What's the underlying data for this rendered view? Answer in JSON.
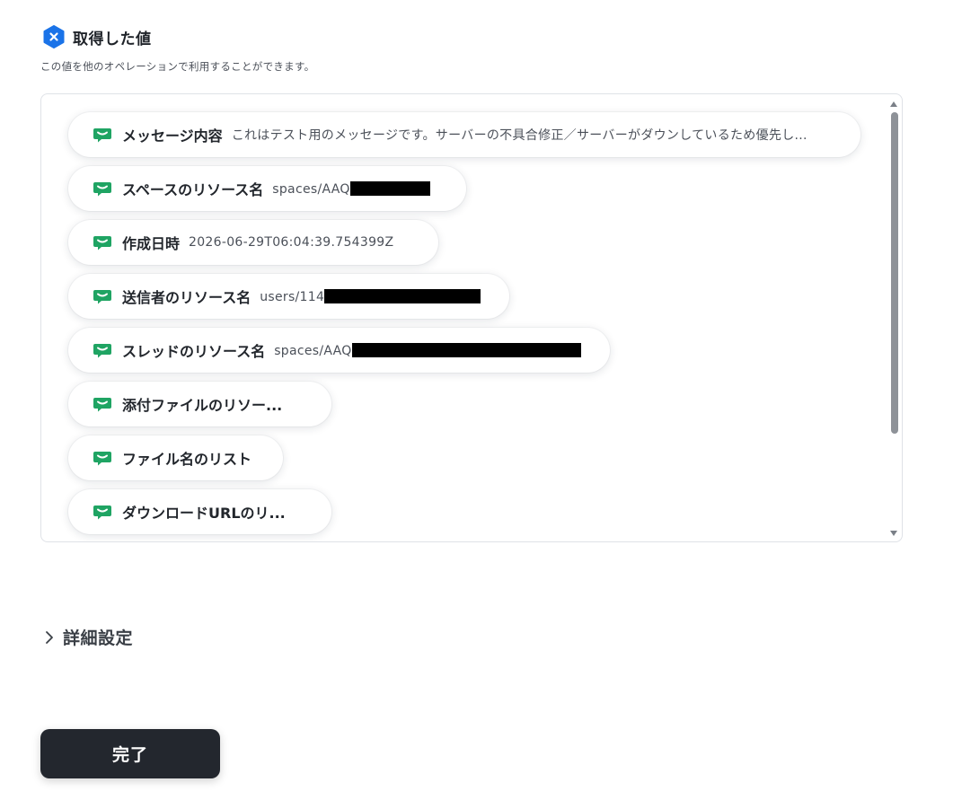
{
  "section": {
    "title": "取得した値",
    "subtitle": "この値を他のオペレーションで利用することができます。",
    "badge_icon": "x-hexagon-icon",
    "badge_color": "#1a73e8"
  },
  "items": [
    {
      "label": "メッセージ内容",
      "value": "これはテスト用のメッセージです。サーバーの不具合修正／サーバーがダウンしているため優先し...",
      "redacted": false
    },
    {
      "label": "スペースのリソース名",
      "value": "spaces/AAQ",
      "redacted": true
    },
    {
      "label": "作成日時",
      "value": "2026-06-29T06:04:39.754399Z",
      "redacted": false
    },
    {
      "label": "送信者のリソース名",
      "value": "users/114",
      "redacted": true
    },
    {
      "label": "スレッドのリソース名",
      "value": "spaces/AAQ",
      "redacted": true
    },
    {
      "label": "添付ファイルのリソー...",
      "value": "",
      "redacted": false
    },
    {
      "label": "ファイル名のリスト",
      "value": "",
      "redacted": false
    },
    {
      "label": "ダウンロードURLのリ...",
      "value": "",
      "redacted": false
    }
  ],
  "item_icon": "google-chat-icon",
  "item_icon_color": "#1fa463",
  "advanced": {
    "label": "詳細設定",
    "icon": "chevron-right-icon"
  },
  "done_button": {
    "label": "完了"
  }
}
